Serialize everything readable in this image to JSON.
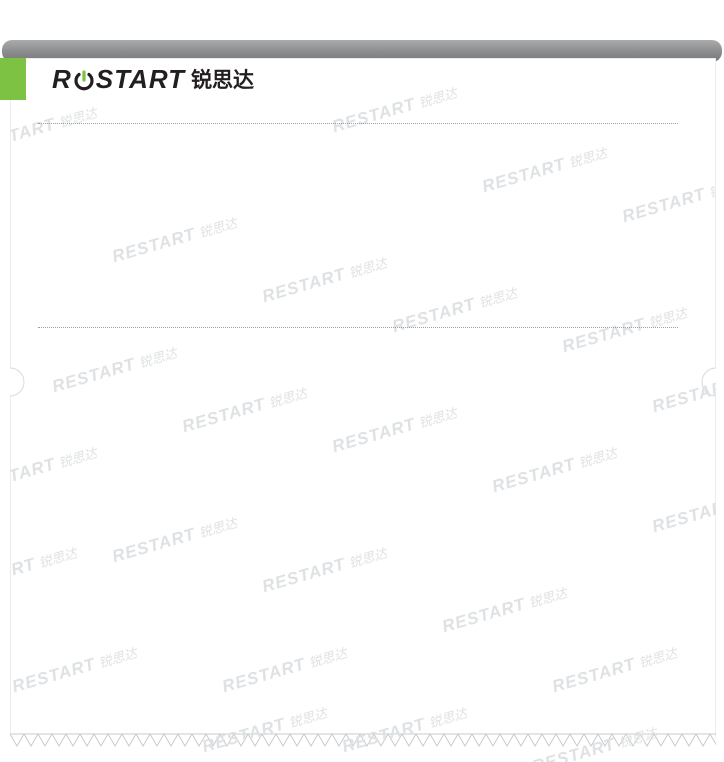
{
  "brand": {
    "name": "RESTART",
    "name_before_o": "R",
    "name_after_o": "START",
    "chinese_name": "锐思达",
    "accent_color": "#7dc242",
    "logo_icon": "power-o-icon"
  },
  "watermark": {
    "text": "RESTART",
    "chinese_text": "锐思达",
    "color": "#dfe2e4"
  },
  "receipt": {
    "paper_color": "#ffffff",
    "slot_color": "#8a8c8e"
  }
}
